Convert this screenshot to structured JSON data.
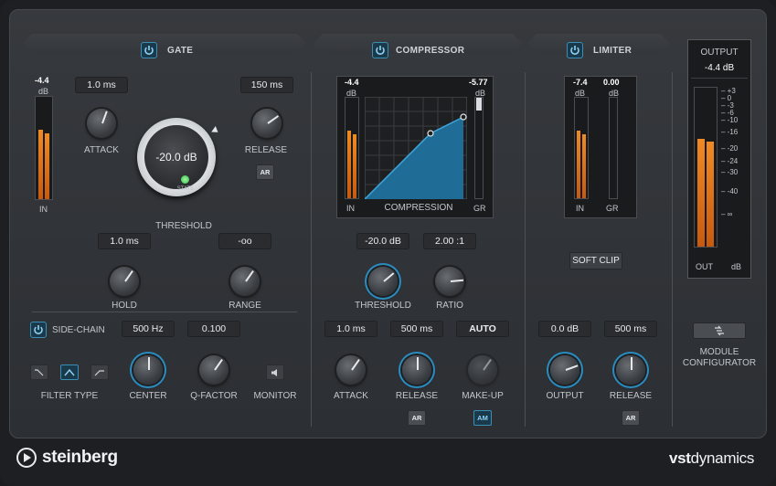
{
  "gate": {
    "title": "GATE",
    "in_meter": {
      "peak": "-4.4",
      "unit": "dB",
      "label": "IN"
    },
    "attack": {
      "value": "1.0 ms",
      "label": "ATTACK"
    },
    "release": {
      "value": "150 ms",
      "label": "RELEASE",
      "ar": "AR"
    },
    "threshold": {
      "value": "-20.0 dB",
      "label": "THRESHOLD",
      "state": "STATE"
    },
    "hold": {
      "value": "1.0 ms",
      "label": "HOLD"
    },
    "range": {
      "value": "-oo",
      "label": "RANGE"
    },
    "sidechain": {
      "label": "SIDE-CHAIN",
      "center_value": "500 Hz",
      "qfactor_value": "0.100",
      "filter_type_label": "FILTER TYPE",
      "center_label": "CENTER",
      "qfactor_label": "Q-FACTOR",
      "monitor_label": "MONITOR"
    }
  },
  "compressor": {
    "title": "COMPRESSOR",
    "in_peak": "-4.4",
    "in_unit": "dB",
    "in_label": "IN",
    "gr_peak": "-5.77",
    "gr_unit": "dB",
    "gr_label": "GR",
    "graph_label": "COMPRESSION",
    "threshold": {
      "value": "-20.0 dB",
      "label": "THRESHOLD"
    },
    "ratio": {
      "value": "2.00 :1",
      "label": "RATIO"
    },
    "attack": {
      "value": "1.0 ms",
      "label": "ATTACK"
    },
    "release": {
      "value": "500 ms",
      "label": "RELEASE",
      "ar": "AR"
    },
    "makeup": {
      "value": "AUTO",
      "label": "MAKE-UP",
      "am": "AM"
    }
  },
  "limiter": {
    "title": "LIMITER",
    "in_peak": "-7.4",
    "in_unit": "dB",
    "in_label": "IN",
    "gr_peak": "0.00",
    "gr_unit": "dB",
    "gr_label": "GR",
    "soft_clip": "SOFT CLIP",
    "output": {
      "value": "0.0 dB",
      "label": "OUTPUT"
    },
    "release": {
      "value": "500 ms",
      "label": "RELEASE",
      "ar": "AR"
    }
  },
  "output": {
    "title": "OUTPUT",
    "value": "-4.4 dB",
    "out_label": "OUT",
    "db_label": "dB",
    "scale": [
      "+3",
      "0",
      "-3",
      "-6",
      "-10",
      "-16",
      "-20",
      "-24",
      "-30",
      "-40",
      "∞"
    ]
  },
  "module_configurator": {
    "line1": "MODULE",
    "line2": "CONFIGURATOR"
  },
  "footer": {
    "brand": "steinberg",
    "product_bold": "vst",
    "product_light": "dynamics"
  },
  "colors": {
    "accent": "#2a8cbf",
    "meter": "#f08a24",
    "graph_fill": "#1f6d96",
    "led": "#4ee05a"
  }
}
